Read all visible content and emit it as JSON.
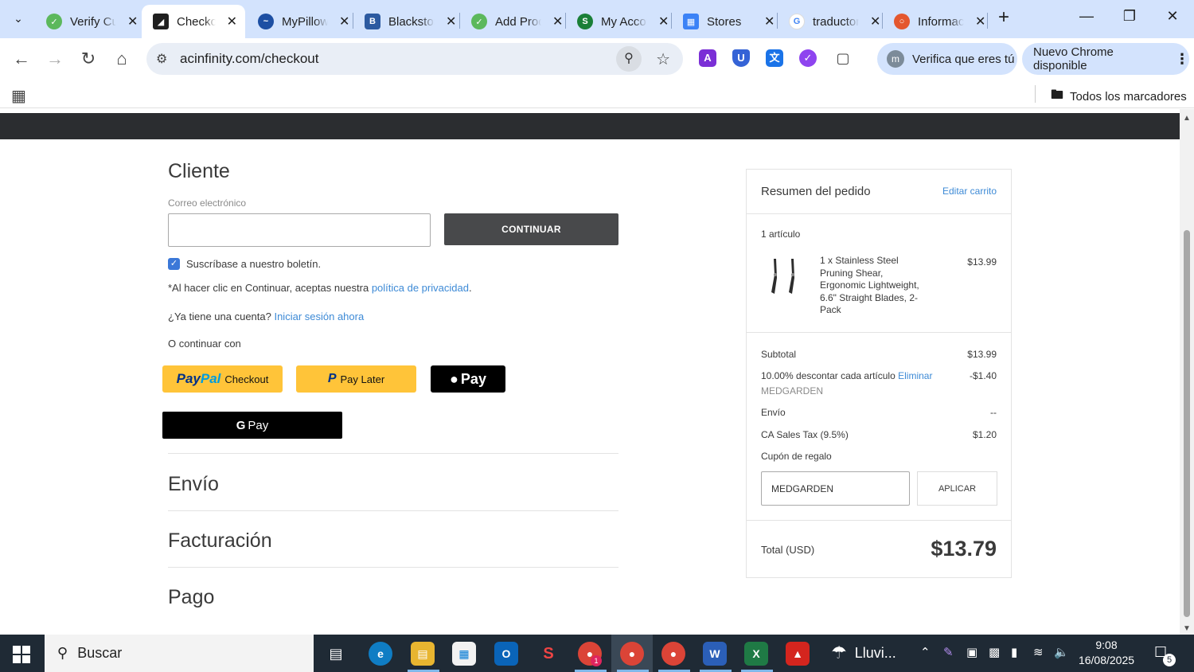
{
  "browser": {
    "tabs": [
      {
        "label": "Verify Customer",
        "icon": "vmp-icon",
        "color": "#5cb85c",
        "active": false
      },
      {
        "label": "Checkout",
        "icon": "acinfinity-icon",
        "color": "#1f1f1f",
        "active": true
      },
      {
        "label": "MyPillow",
        "icon": "mypillow-icon",
        "color": "#1d4fa3",
        "active": false
      },
      {
        "label": "Blackstone",
        "icon": "blackstone-icon",
        "color": "#2c5aa0",
        "active": false
      },
      {
        "label": "Add Product",
        "icon": "vmp-icon",
        "color": "#5cb85c",
        "active": false
      },
      {
        "label": "My Account",
        "icon": "s-icon",
        "color": "#1a7f37",
        "active": false
      },
      {
        "label": "Stores",
        "icon": "stores-icon",
        "color": "#3b82f6",
        "active": false
      },
      {
        "label": "traductor",
        "icon": "google-icon",
        "color": "#4285f4",
        "active": false
      },
      {
        "label": "Información",
        "icon": "info-icon",
        "color": "#e4572e",
        "active": false
      }
    ],
    "url": "acinfinity.com/checkout",
    "verify_chip": "Verifica que eres tú",
    "verify_chip_initial": "m",
    "update_chip": "Nuevo Chrome disponible",
    "bookmarks_all": "Todos los marcadores"
  },
  "checkout": {
    "customer_title": "Cliente",
    "email_label": "Correo electrónico",
    "email_value": "",
    "continue_label": "CONTINUAR",
    "newsletter_label": "Suscríbase a nuestro boletín.",
    "newsletter_checked": true,
    "privacy_prefix": "*Al hacer clic en Continuar, aceptas nuestra ",
    "privacy_link": "política de privacidad",
    "privacy_suffix": ".",
    "account_prefix": "¿Ya tiene una cuenta? ",
    "account_link": "Iniciar sesión ahora",
    "or_continue": "O continuar con",
    "paypal": {
      "pay": "Pay",
      "pal": "Pal",
      "checkout": "Checkout"
    },
    "paylater": {
      "mark": "P",
      "label": "Pay Later"
    },
    "applepay": "Pay",
    "gpay": {
      "g": "G",
      "label": "Pay"
    },
    "sections": [
      "Envío",
      "Facturación",
      "Pago"
    ]
  },
  "summary": {
    "title": "Resumen del pedido",
    "edit_link": "Editar carrito",
    "item_count": "1 artículo",
    "product_name": "1 x Stainless Steel Pruning Shear, Ergonomic Lightweight, 6.6\" Straight Blades, 2-Pack",
    "product_price": "$13.99",
    "subtotal_label": "Subtotal",
    "subtotal_value": "$13.99",
    "discount_label": "10.00% descontar cada artículo ",
    "discount_remove": "Eliminar",
    "discount_value": "-$1.40",
    "discount_code": "MEDGARDEN",
    "shipping_label": "Envío",
    "shipping_value": "--",
    "tax_label": "CA Sales Tax (9.5%)",
    "tax_value": "$1.20",
    "gift_link": "Cupón de regalo",
    "coupon_value": "MEDGARDEN",
    "apply_label": "APLICAR",
    "total_label": "Total (USD)",
    "total_value": "$13.79"
  },
  "taskbar": {
    "search_placeholder": "Buscar",
    "weather": "Lluvi...",
    "time": "9:08",
    "date": "16/08/2025",
    "notifications": "5",
    "chrome_badge": "1",
    "word_letter": "W",
    "excel_letter": "X"
  }
}
